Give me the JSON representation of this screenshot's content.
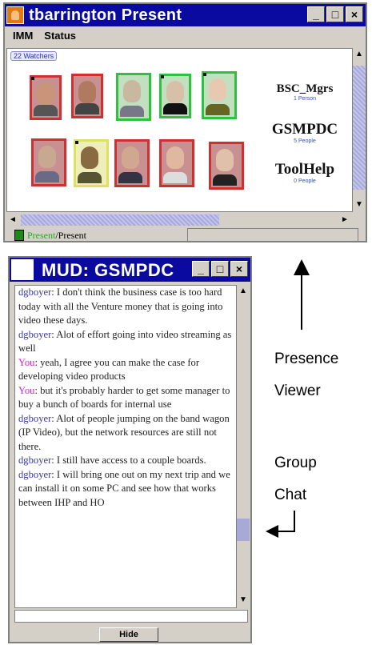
{
  "presence_window": {
    "title": "tbarrington Present",
    "menu": [
      "IMM",
      "Status"
    ],
    "watchers_tag": "22 Watchers",
    "groups": [
      {
        "name": "BSC_Mgrs",
        "count": "1 Person"
      },
      {
        "name": "GSMPDC",
        "count": "5 People"
      },
      {
        "name": "ToolHelp",
        "count": "0 People"
      }
    ],
    "status_present_green": "Present",
    "status_present_rest": "/Present"
  },
  "chat_window": {
    "title": "MUD: GSMPDC",
    "hide_label": "Hide",
    "messages": [
      {
        "who": "dgboyer",
        "type": "other",
        "text": " I don't think the business case is too hard today with all the Venture money that is going into video these days."
      },
      {
        "who": "dgboyer",
        "type": "other",
        "text": " Alot of effort going into video streaming as well"
      },
      {
        "who": "You",
        "type": "self",
        "text": " yeah, I agree you can make the case for developing video products"
      },
      {
        "who": "You",
        "type": "self",
        "text": " but it's probably harder to get some manager to buy a bunch of boards for internal use"
      },
      {
        "who": "dgboyer",
        "type": "other",
        "text": " Alot of people jumping on the band wagon (IP Video), but the network resources are still not there."
      },
      {
        "who": "dgboyer",
        "type": "other",
        "text": " I still have access to a couple boards."
      },
      {
        "who": "dgboyer",
        "type": "other",
        "text": " I will bring one out on my next trip and we can install it on some PC and see how that works between IHP and HO"
      }
    ]
  },
  "annotations": {
    "presence_line1": "Presence",
    "presence_line2": "Viewer",
    "group_line1": "Group",
    "group_line2": "Chat"
  },
  "colors": {
    "titlebar": "#0a0aa0",
    "present_green": "#22aa22",
    "self_name": "#cc22cc",
    "other_name": "#3a3aa0"
  },
  "icons": [
    "person-icon",
    "minimize-icon",
    "maximize-icon",
    "close-icon",
    "arrow-up-icon",
    "arrow-left-icon"
  ]
}
